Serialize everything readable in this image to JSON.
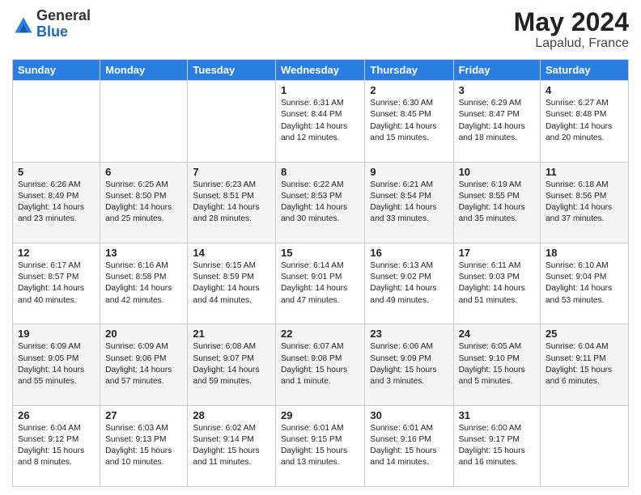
{
  "header": {
    "logo_general": "General",
    "logo_blue": "Blue",
    "month_title": "May 2024",
    "location": "Lapalud, France"
  },
  "days_of_week": [
    "Sunday",
    "Monday",
    "Tuesday",
    "Wednesday",
    "Thursday",
    "Friday",
    "Saturday"
  ],
  "weeks": [
    [
      {
        "day": "",
        "content": ""
      },
      {
        "day": "",
        "content": ""
      },
      {
        "day": "",
        "content": ""
      },
      {
        "day": "1",
        "content": "Sunrise: 6:31 AM\nSunset: 8:44 PM\nDaylight: 14 hours and 12 minutes."
      },
      {
        "day": "2",
        "content": "Sunrise: 6:30 AM\nSunset: 8:45 PM\nDaylight: 14 hours and 15 minutes."
      },
      {
        "day": "3",
        "content": "Sunrise: 6:29 AM\nSunset: 8:47 PM\nDaylight: 14 hours and 18 minutes."
      },
      {
        "day": "4",
        "content": "Sunrise: 6:27 AM\nSunset: 8:48 PM\nDaylight: 14 hours and 20 minutes."
      }
    ],
    [
      {
        "day": "5",
        "content": "Sunrise: 6:26 AM\nSunset: 8:49 PM\nDaylight: 14 hours and 23 minutes."
      },
      {
        "day": "6",
        "content": "Sunrise: 6:25 AM\nSunset: 8:50 PM\nDaylight: 14 hours and 25 minutes."
      },
      {
        "day": "7",
        "content": "Sunrise: 6:23 AM\nSunset: 8:51 PM\nDaylight: 14 hours and 28 minutes."
      },
      {
        "day": "8",
        "content": "Sunrise: 6:22 AM\nSunset: 8:53 PM\nDaylight: 14 hours and 30 minutes."
      },
      {
        "day": "9",
        "content": "Sunrise: 6:21 AM\nSunset: 8:54 PM\nDaylight: 14 hours and 33 minutes."
      },
      {
        "day": "10",
        "content": "Sunrise: 6:19 AM\nSunset: 8:55 PM\nDaylight: 14 hours and 35 minutes."
      },
      {
        "day": "11",
        "content": "Sunrise: 6:18 AM\nSunset: 8:56 PM\nDaylight: 14 hours and 37 minutes."
      }
    ],
    [
      {
        "day": "12",
        "content": "Sunrise: 6:17 AM\nSunset: 8:57 PM\nDaylight: 14 hours and 40 minutes."
      },
      {
        "day": "13",
        "content": "Sunrise: 6:16 AM\nSunset: 8:58 PM\nDaylight: 14 hours and 42 minutes."
      },
      {
        "day": "14",
        "content": "Sunrise: 6:15 AM\nSunset: 8:59 PM\nDaylight: 14 hours and 44 minutes."
      },
      {
        "day": "15",
        "content": "Sunrise: 6:14 AM\nSunset: 9:01 PM\nDaylight: 14 hours and 47 minutes."
      },
      {
        "day": "16",
        "content": "Sunrise: 6:13 AM\nSunset: 9:02 PM\nDaylight: 14 hours and 49 minutes."
      },
      {
        "day": "17",
        "content": "Sunrise: 6:11 AM\nSunset: 9:03 PM\nDaylight: 14 hours and 51 minutes."
      },
      {
        "day": "18",
        "content": "Sunrise: 6:10 AM\nSunset: 9:04 PM\nDaylight: 14 hours and 53 minutes."
      }
    ],
    [
      {
        "day": "19",
        "content": "Sunrise: 6:09 AM\nSunset: 9:05 PM\nDaylight: 14 hours and 55 minutes."
      },
      {
        "day": "20",
        "content": "Sunrise: 6:09 AM\nSunset: 9:06 PM\nDaylight: 14 hours and 57 minutes."
      },
      {
        "day": "21",
        "content": "Sunrise: 6:08 AM\nSunset: 9:07 PM\nDaylight: 14 hours and 59 minutes."
      },
      {
        "day": "22",
        "content": "Sunrise: 6:07 AM\nSunset: 9:08 PM\nDaylight: 15 hours and 1 minute."
      },
      {
        "day": "23",
        "content": "Sunrise: 6:06 AM\nSunset: 9:09 PM\nDaylight: 15 hours and 3 minutes."
      },
      {
        "day": "24",
        "content": "Sunrise: 6:05 AM\nSunset: 9:10 PM\nDaylight: 15 hours and 5 minutes."
      },
      {
        "day": "25",
        "content": "Sunrise: 6:04 AM\nSunset: 9:11 PM\nDaylight: 15 hours and 6 minutes."
      }
    ],
    [
      {
        "day": "26",
        "content": "Sunrise: 6:04 AM\nSunset: 9:12 PM\nDaylight: 15 hours and 8 minutes."
      },
      {
        "day": "27",
        "content": "Sunrise: 6:03 AM\nSunset: 9:13 PM\nDaylight: 15 hours and 10 minutes."
      },
      {
        "day": "28",
        "content": "Sunrise: 6:02 AM\nSunset: 9:14 PM\nDaylight: 15 hours and 11 minutes."
      },
      {
        "day": "29",
        "content": "Sunrise: 6:01 AM\nSunset: 9:15 PM\nDaylight: 15 hours and 13 minutes."
      },
      {
        "day": "30",
        "content": "Sunrise: 6:01 AM\nSunset: 9:16 PM\nDaylight: 15 hours and 14 minutes."
      },
      {
        "day": "31",
        "content": "Sunrise: 6:00 AM\nSunset: 9:17 PM\nDaylight: 15 hours and 16 minutes."
      },
      {
        "day": "",
        "content": ""
      }
    ]
  ]
}
